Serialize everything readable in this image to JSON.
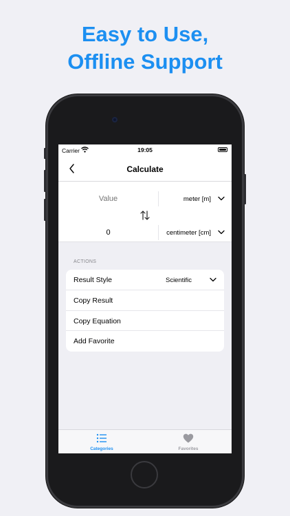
{
  "promo": {
    "headline_line1": "Easy to Use,",
    "headline_line2": "Offline Support"
  },
  "status_bar": {
    "carrier": "Carrier",
    "time": "19:05"
  },
  "nav": {
    "title": "Calculate",
    "back_icon": "chevron-left-icon"
  },
  "converter": {
    "input_placeholder": "Value",
    "from_unit": "meter [m]",
    "result_value": "0",
    "to_unit": "centimeter [cm]"
  },
  "actions": {
    "header": "ACTIONS",
    "result_style_label": "Result Style",
    "result_style_value": "Scientific",
    "copy_result": "Copy Result",
    "copy_equation": "Copy Equation",
    "add_favorite": "Add Favorite"
  },
  "tabbar": {
    "categories": "Categories",
    "favorites": "Favorites"
  },
  "colors": {
    "accent": "#1c8ff1",
    "background": "#f0f0f5",
    "phone_body": "#1a1a1c"
  }
}
